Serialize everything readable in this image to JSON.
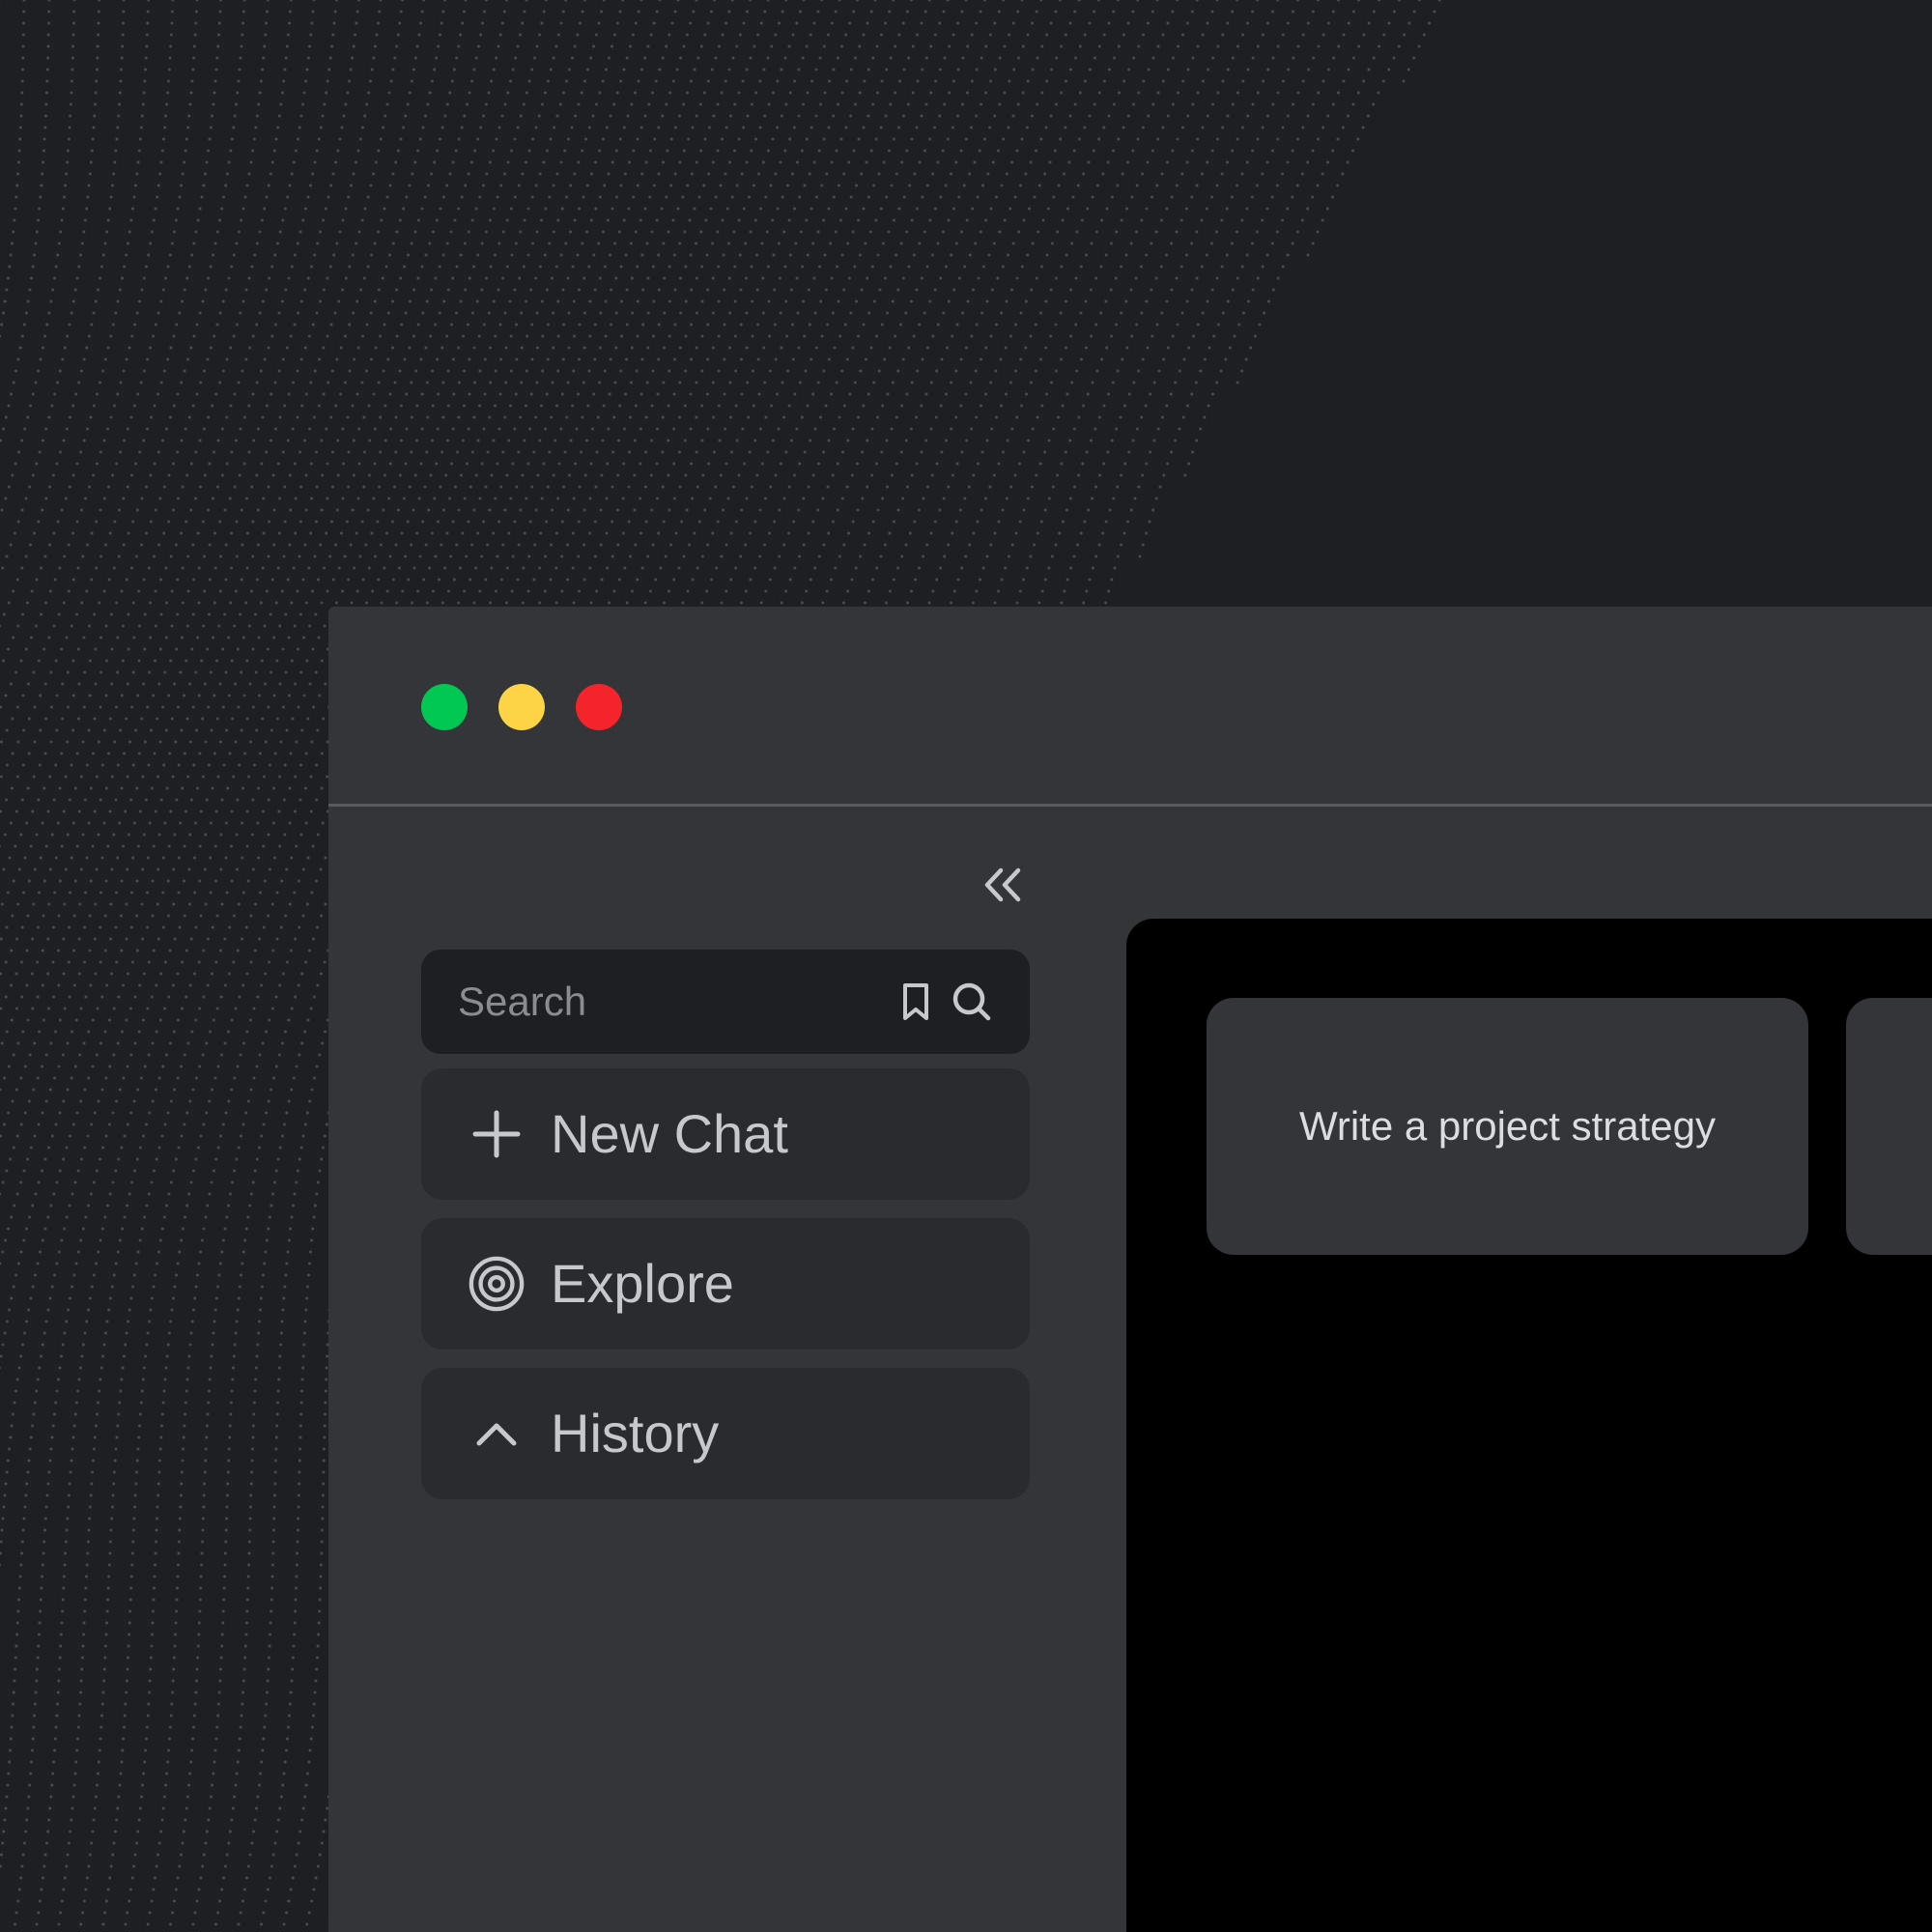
{
  "window": {
    "controls": [
      {
        "name": "green",
        "color": "#00c853"
      },
      {
        "name": "yellow",
        "color": "#fdd446"
      },
      {
        "name": "red",
        "color": "#f3242a"
      }
    ]
  },
  "sidebar": {
    "collapse_icon": "double-chevron-left-icon",
    "search": {
      "placeholder": "Search",
      "value": "",
      "icons": [
        "bookmark-icon",
        "search-icon"
      ]
    },
    "items": [
      {
        "label": "New Chat",
        "icon": "plus-icon"
      },
      {
        "label": "Explore",
        "icon": "target-icon"
      },
      {
        "label": "History",
        "icon": "chevron-up-icon"
      }
    ]
  },
  "main": {
    "suggestions": [
      {
        "text": "Write a project strategy"
      },
      {
        "text": ""
      }
    ]
  },
  "colors": {
    "background": "#1e1f23",
    "window": "#343539",
    "sidebar_item": "#292b2e",
    "main": "#000000",
    "text": "#c7c8cc"
  }
}
